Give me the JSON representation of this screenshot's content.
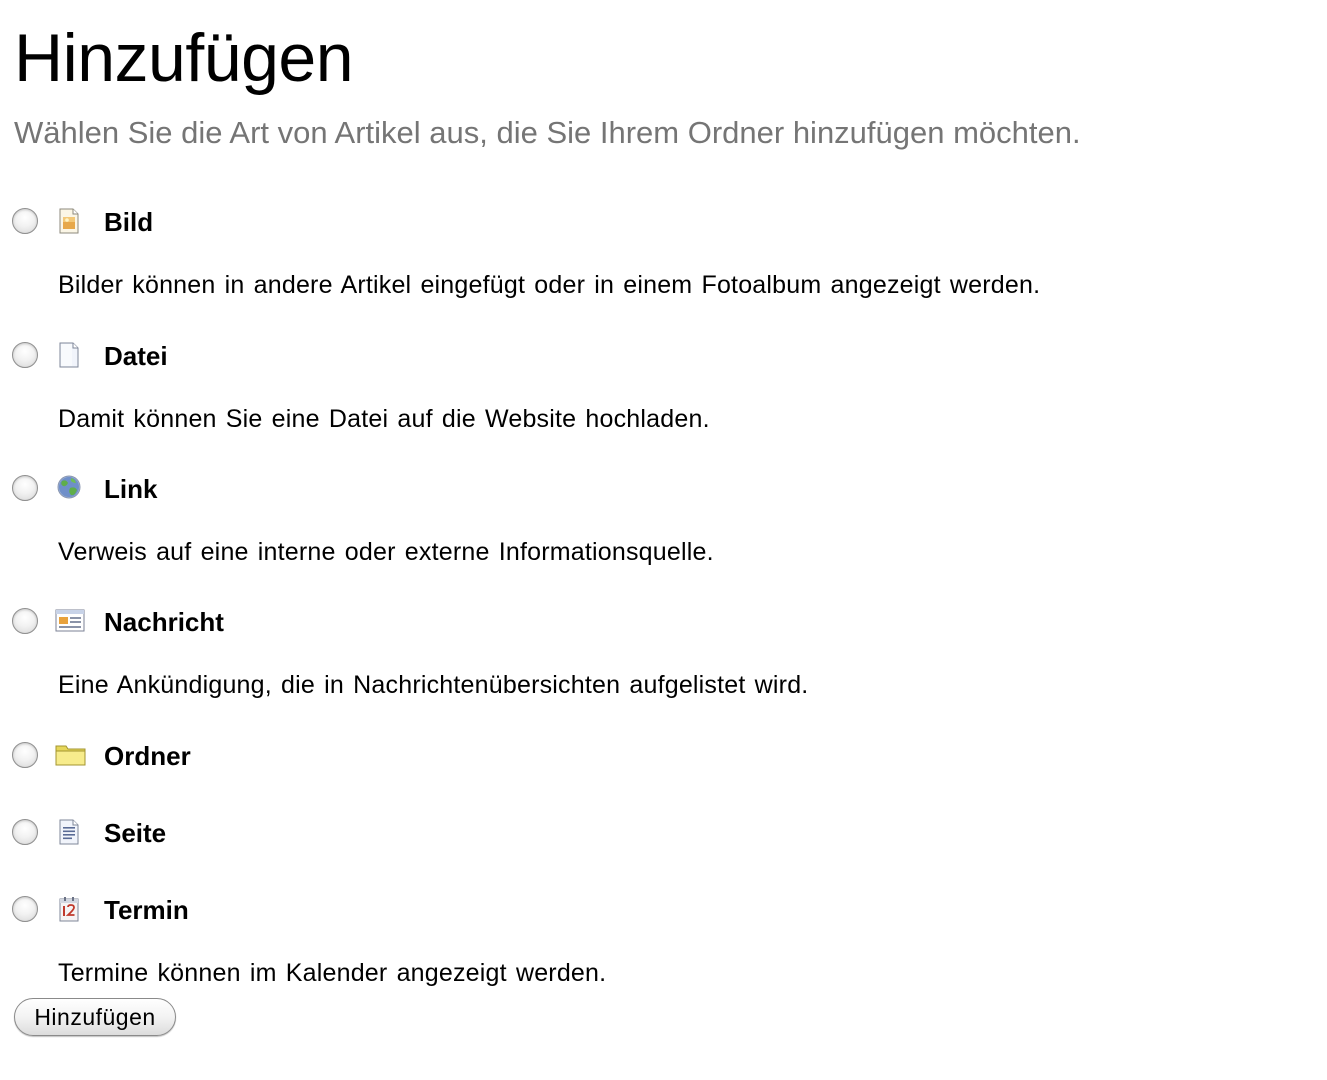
{
  "header": {
    "title": "Hinzufügen",
    "subtitle": "Wählen Sie die Art von Artikel aus, die Sie Ihrem Ordner hinzufügen möchten."
  },
  "types": [
    {
      "label": "Bild",
      "icon": "image-icon",
      "description": "Bilder können in andere Artikel eingefügt oder in einem Fotoalbum angezeigt werden."
    },
    {
      "label": "Datei",
      "icon": "file-icon",
      "description": "Damit können Sie eine Datei auf die Website hochladen."
    },
    {
      "label": "Link",
      "icon": "globe-link-icon",
      "description": "Verweis auf eine interne oder externe Informationsquelle."
    },
    {
      "label": "Nachricht",
      "icon": "news-icon",
      "description": "Eine Ankündigung, die in Nachrichtenübersichten aufgelistet wird."
    },
    {
      "label": "Ordner",
      "icon": "folder-icon",
      "description": ""
    },
    {
      "label": "Seite",
      "icon": "page-icon",
      "description": ""
    },
    {
      "label": "Termin",
      "icon": "calendar-icon",
      "description": "Termine können im Kalender angezeigt werden."
    }
  ],
  "form": {
    "submit_label": "Hinzufügen"
  }
}
